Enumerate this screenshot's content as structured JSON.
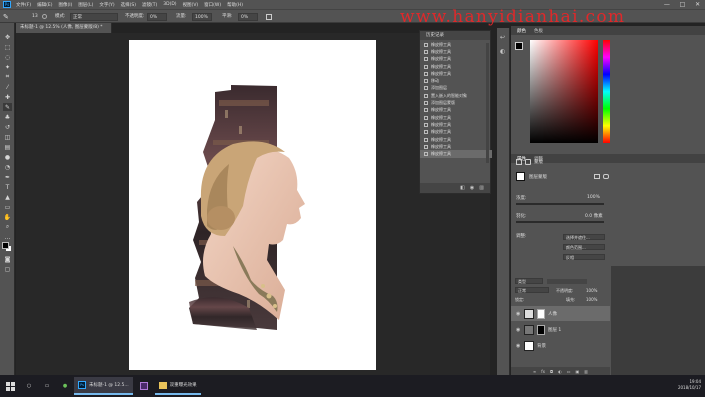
{
  "menubar": {
    "items": [
      "文件(F)",
      "编辑(E)",
      "图像(I)",
      "图层(L)",
      "文字(Y)",
      "选择(S)",
      "滤镜(T)",
      "3D(D)",
      "视图(V)",
      "窗口(W)",
      "帮助(H)"
    ],
    "minimize": "—",
    "maximize": "□",
    "close": "✕"
  },
  "options": {
    "size": "13",
    "mode_label": "模式:",
    "mode": "正常",
    "opacity_label": "不透明度:",
    "opacity": "0%",
    "flow_label": "流量:",
    "flow": "100%",
    "smooth_label": "平滑:",
    "smooth": "0%"
  },
  "watermark": "www.hanyidianhai.com",
  "document": {
    "tab": "未标题-1 @ 12.5% (人像, 图层蒙版/8) *"
  },
  "history": {
    "title": "历史记录",
    "items": [
      "橡皮擦工具",
      "橡皮擦工具",
      "橡皮擦工具",
      "橡皮擦工具",
      "橡皮擦工具",
      "移动",
      "添加图层",
      "置入嵌入的智能对象",
      "添加图层蒙版",
      "橡皮擦工具",
      "橡皮擦工具",
      "橡皮擦工具",
      "橡皮擦工具",
      "橡皮擦工具",
      "橡皮擦工具",
      "橡皮擦工具"
    ],
    "selected_index": 15
  },
  "color_panel": {
    "tabs": [
      "颜色",
      "色板"
    ],
    "foreground": "#000000",
    "background": "#ffffff"
  },
  "properties": {
    "tabs": [
      "属性",
      "调整"
    ],
    "section": "蒙版",
    "layer_mask_label": "图层蒙版",
    "density_label": "浓度:",
    "density": "100%",
    "feather_label": "羽化:",
    "feather": "0.0 像素",
    "refine_label": "调整:",
    "select_and_mask": "选择并遮住...",
    "color_range": "颜色范围...",
    "invert": "反相"
  },
  "layers": {
    "tabs": [
      "图层",
      "通道",
      "路径"
    ],
    "filter_label": "类型",
    "blend_mode": "正常",
    "opacity_label": "不透明度:",
    "opacity": "100%",
    "lock_label": "锁定:",
    "fill_label": "填充:",
    "fill": "100%",
    "items": [
      {
        "name": "人像",
        "has_mask": true,
        "selected": true
      },
      {
        "name": "图层 1",
        "has_mask": true,
        "selected": false
      },
      {
        "name": "背景",
        "has_mask": false,
        "selected": false
      }
    ]
  },
  "taskbar": {
    "start_icon": "windows-logo",
    "search_icon": "search-icon",
    "ps_label": "未标题-1 @ 12.5...",
    "folder_label": "双重曝光效果",
    "time": "19:04",
    "date": "2018/10/17"
  }
}
